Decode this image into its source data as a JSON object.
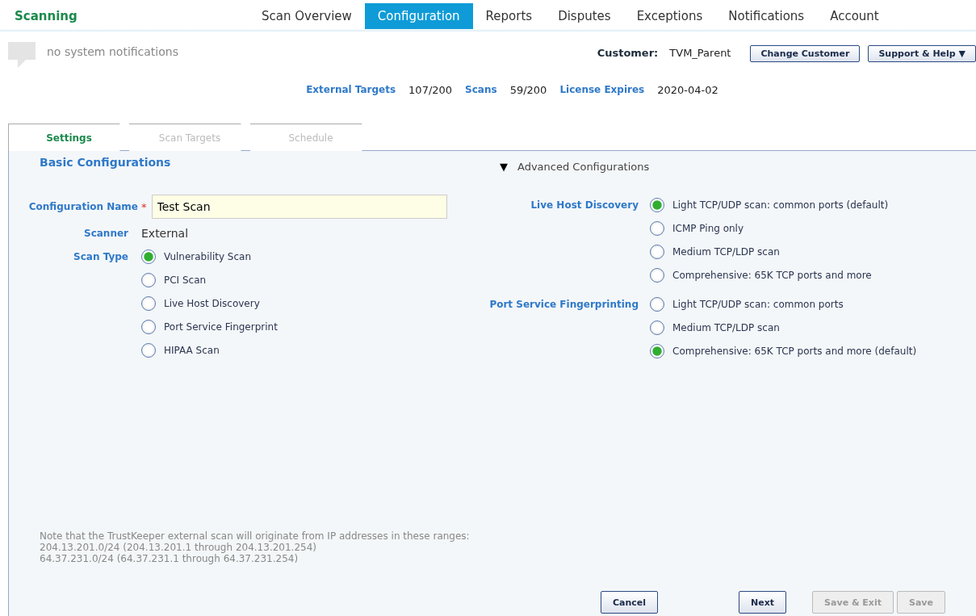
{
  "app_title": "Scanning",
  "nav": [
    {
      "label": "Scan Overview",
      "selected": false
    },
    {
      "label": "Configuration",
      "selected": true
    },
    {
      "label": "Reports",
      "selected": false
    },
    {
      "label": "Disputes",
      "selected": false
    },
    {
      "label": "Exceptions",
      "selected": false
    },
    {
      "label": "Notifications",
      "selected": false
    },
    {
      "label": "Account",
      "selected": false
    }
  ],
  "notifications": "no system notifications",
  "customer": {
    "label": "Customer:",
    "value": "TVM_Parent"
  },
  "header_buttons": [
    "Change Customer",
    "Support & Help ▼"
  ],
  "stats": [
    {
      "label": "External Targets",
      "value": "107/200"
    },
    {
      "label": "Scans",
      "value": "59/200"
    },
    {
      "label": "License Expires",
      "value": "2020-04-02"
    }
  ],
  "steps": [
    {
      "label": "Settings",
      "selected": true
    },
    {
      "label": "Scan Targets",
      "selected": false
    },
    {
      "label": "Schedule",
      "selected": false
    }
  ],
  "basic": {
    "title": "Basic Configurations",
    "name_label": "Configuration Name",
    "required_mark": "*",
    "name_value": "Test Scan",
    "scanner_label": "Scanner",
    "scanner_value": "External",
    "scan_type_label": "Scan Type",
    "scan_types": [
      {
        "label": "Vulnerability Scan",
        "selected": true
      },
      {
        "label": "PCI Scan",
        "selected": false
      },
      {
        "label": "Live Host Discovery",
        "selected": false
      },
      {
        "label": "Port Service Fingerprint",
        "selected": false
      },
      {
        "label": "HIPAA Scan",
        "selected": false
      }
    ]
  },
  "advanced": {
    "toggle": "▼",
    "title": "Advanced Configurations",
    "expanded": true,
    "groups": [
      {
        "label": "Live Host Discovery",
        "options": [
          {
            "label": "Light TCP/UDP scan: common ports (default)",
            "selected": true
          },
          {
            "label": "ICMP Ping only",
            "selected": false
          },
          {
            "label": "Medium TCP/LDP scan",
            "selected": false
          },
          {
            "label": "Comprehensive: 65K TCP ports and more",
            "selected": false
          }
        ]
      },
      {
        "label": "Port Service Fingerprinting",
        "options": [
          {
            "label": "Light TCP/UDP scan: common ports",
            "selected": false
          },
          {
            "label": "Medium TCP/LDP scan",
            "selected": false
          },
          {
            "label": "Comprehensive: 65K TCP ports and more (default)",
            "selected": true
          }
        ]
      }
    ]
  },
  "note": [
    "Note that the TrustKeeper external scan will originate from IP addresses in these ranges:",
    "204.13.201.0/24 (204.13.201.1 through 204.13.201.254)",
    "64.37.231.0/24 (64.37.231.1 through 64.37.231.254)"
  ],
  "buttons": [
    {
      "label": "Cancel",
      "disabled": false
    },
    {
      "label": "Next",
      "disabled": false
    },
    {
      "label": "Save & Exit",
      "disabled": true
    },
    {
      "label": "Save",
      "disabled": true
    }
  ]
}
